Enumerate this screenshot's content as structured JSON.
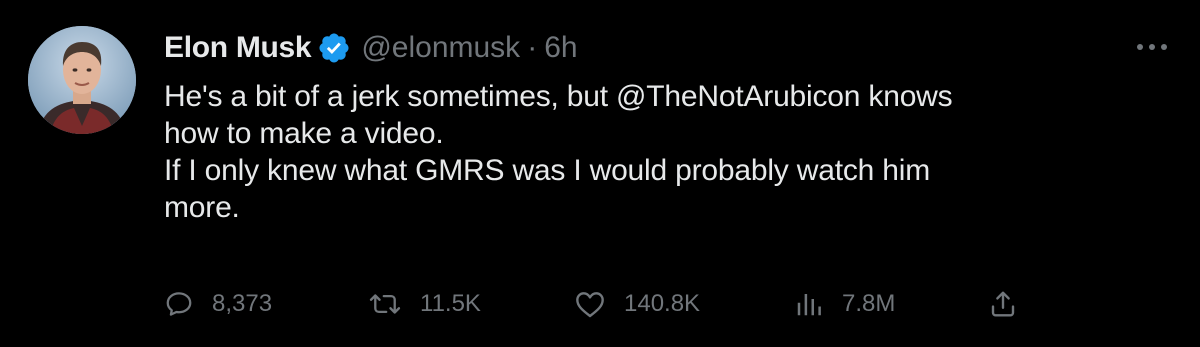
{
  "tweet": {
    "author": {
      "display_name": "Elon Musk",
      "verified": true,
      "handle": "@elonmusk",
      "separator": "·",
      "time": "6h"
    },
    "text_lines": [
      "He's a bit of a jerk sometimes, but @TheNotArubicon knows\nhow to make a video.",
      "If I only knew what GMRS was I would probably watch him\nmore."
    ],
    "actions": {
      "replies": "8,373",
      "reposts": "11.5K",
      "likes": "140.8K",
      "views": "7.8M"
    },
    "icons": {
      "verified": "verified-badge-icon",
      "more": "more-dots-icon",
      "reply": "reply-icon",
      "repost": "repost-icon",
      "like": "heart-icon",
      "views": "views-chart-icon",
      "share": "share-icon"
    },
    "colors": {
      "background": "#000000",
      "text": "#e7e9ea",
      "muted": "#71767b",
      "verified_blue": "#1d9bf0"
    }
  }
}
